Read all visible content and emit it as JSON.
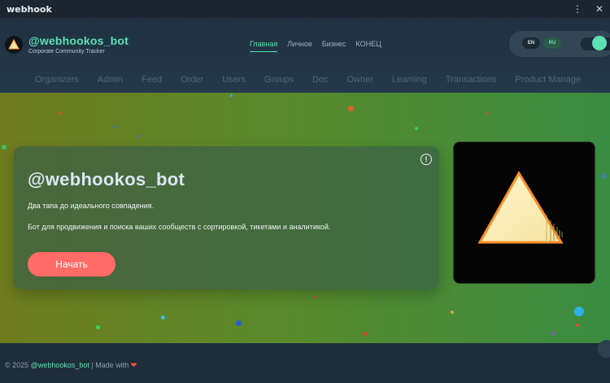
{
  "window": {
    "title": "webhook",
    "menu_icon": "⋮",
    "close_icon": "✕"
  },
  "brand": {
    "title": "@webhookos_bot",
    "subtitle": "Corporate Community Tracker"
  },
  "topnav": [
    {
      "label": "Главная",
      "active": true
    },
    {
      "label": "Личное"
    },
    {
      "label": "Бизнес"
    },
    {
      "label": "КОНЕЦ"
    }
  ],
  "language": {
    "en": "EN",
    "ru": "RU",
    "selected": "RU"
  },
  "menu": [
    "Organizers",
    "Admin",
    "Feed",
    "Order",
    "Users",
    "Groups",
    "Doc",
    "Owner",
    "Learning",
    "Transactions",
    "Product Manage"
  ],
  "hero": {
    "title": "@webhookos_bot",
    "line1": "Два тапа до идеального совпадения.",
    "line2": "Бот для продвижения и поиска ваших сообществ с сортировкой, тикетами и аналитикой.",
    "cta": "Начать",
    "info_icon": "!"
  },
  "footer": {
    "prefix": "© 2025",
    "handle": "@webhookos_bot",
    "suffix": "| Made with",
    "heart": "❤"
  },
  "colors": {
    "accent": "#5ee0b4",
    "cta": "#ff6b66",
    "background": "#1c2a36"
  }
}
